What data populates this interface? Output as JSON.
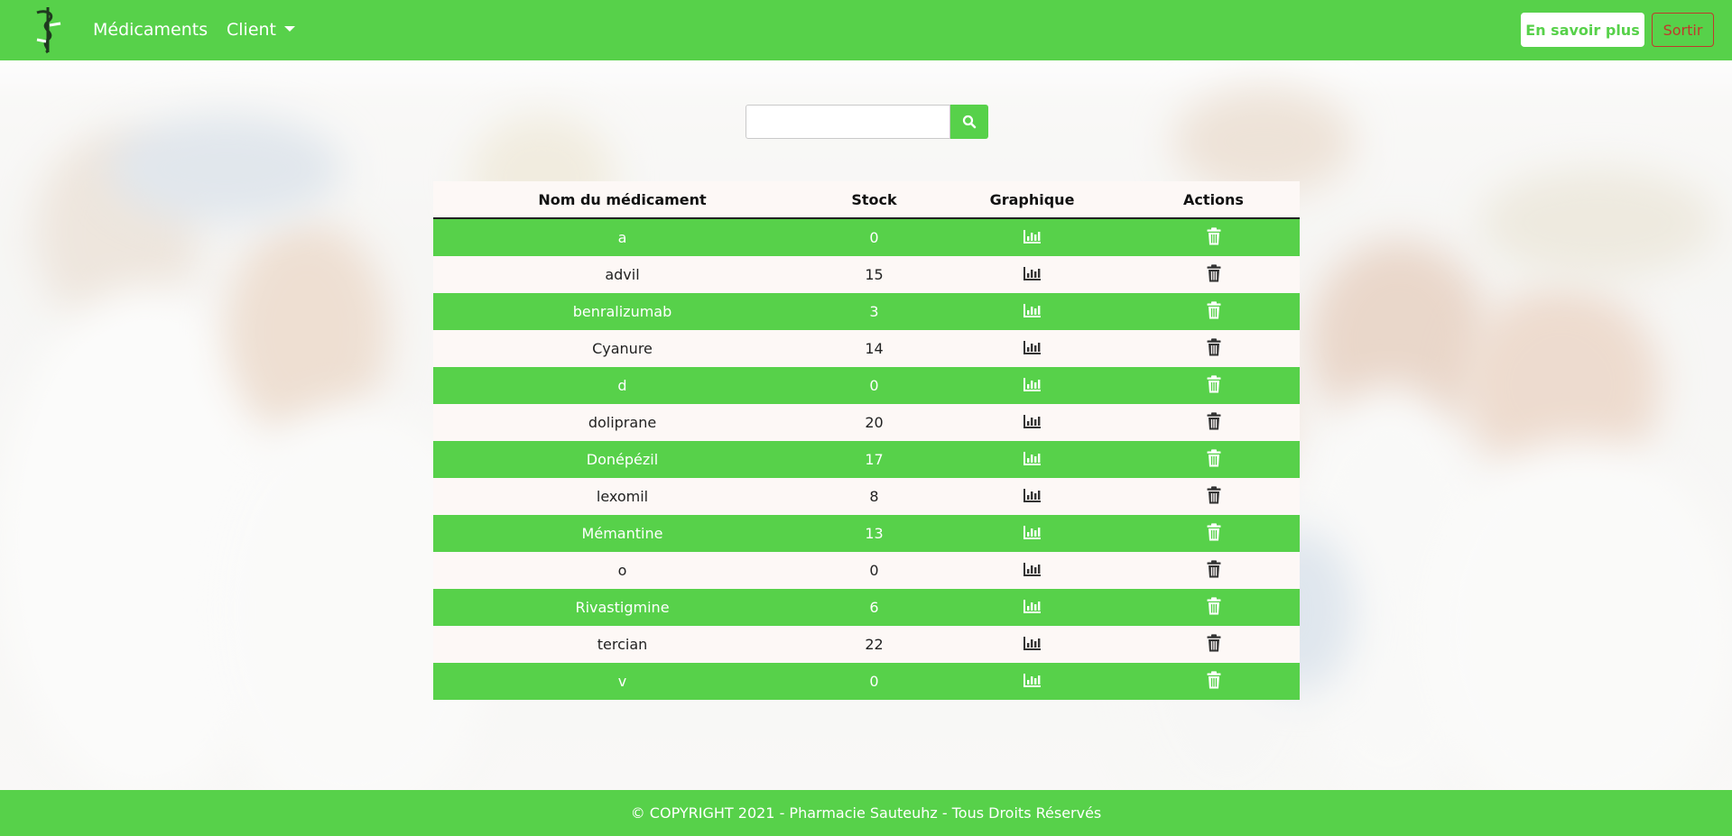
{
  "navbar": {
    "logo_icon": "caduceus-logo-icon",
    "links": {
      "medicaments": "Médicaments",
      "client": "Client"
    },
    "buttons": {
      "learn_more": "En savoir plus",
      "exit": "Sortir"
    },
    "colors": {
      "brand": "#57d14a",
      "exit": "#c0392b"
    }
  },
  "search": {
    "value": "",
    "placeholder": "",
    "button_icon": "search-icon"
  },
  "table": {
    "headers": [
      "Nom du médicament",
      "Stock",
      "Graphique",
      "Actions"
    ],
    "chart_icon": "bar-chart-icon",
    "delete_icon": "trash-icon",
    "rows": [
      {
        "name": "a",
        "stock": "0"
      },
      {
        "name": "advil",
        "stock": "15"
      },
      {
        "name": "benralizumab",
        "stock": "3"
      },
      {
        "name": "Cyanure",
        "stock": "14"
      },
      {
        "name": "d",
        "stock": "0"
      },
      {
        "name": "doliprane",
        "stock": "20"
      },
      {
        "name": "Donépézil",
        "stock": "17"
      },
      {
        "name": "lexomil",
        "stock": "8"
      },
      {
        "name": "Mémantine",
        "stock": "13"
      },
      {
        "name": "o",
        "stock": "0"
      },
      {
        "name": "Rivastigmine",
        "stock": "6"
      },
      {
        "name": "tercian",
        "stock": "22"
      },
      {
        "name": "v",
        "stock": "0"
      }
    ]
  },
  "footer": {
    "text": "© COPYRIGHT 2021 - Pharmacie Sauteuhz - Tous Droits Réservés"
  }
}
